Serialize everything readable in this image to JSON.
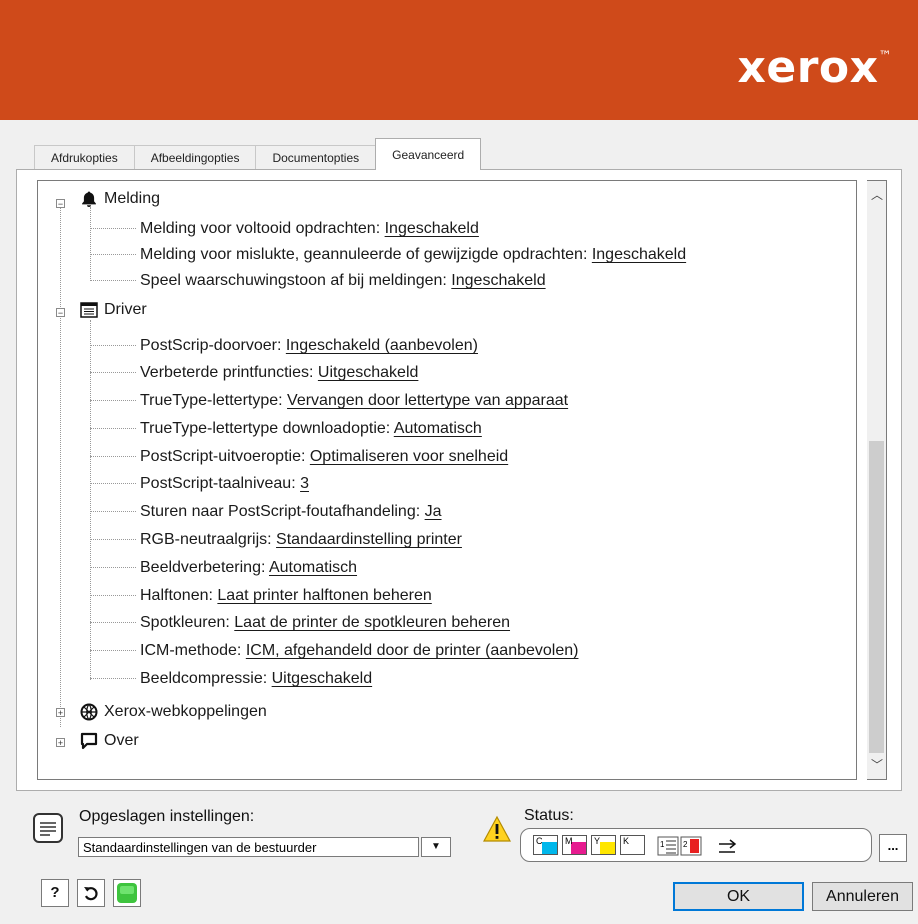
{
  "header": {
    "brand": "xerox",
    "brand_mark": "™",
    "background_color": "#cf4a1a"
  },
  "tabs": [
    {
      "label": "Afdrukopties",
      "active": false
    },
    {
      "label": "Afbeeldingopties",
      "active": false
    },
    {
      "label": "Documentopties",
      "active": false
    },
    {
      "label": "Geavanceerd",
      "active": true
    }
  ],
  "tree": {
    "melding": {
      "label": "Melding",
      "icon": "bell-icon",
      "items": [
        {
          "label": "Melding voor voltooid opdrachten: ",
          "value": "Ingeschakeld"
        },
        {
          "label": "Melding voor mislukte, geannuleerde of gewijzigde opdrachten: ",
          "value": "Ingeschakeld"
        },
        {
          "label": "Speel waarschuwingstoon af bij meldingen: ",
          "value": "Ingeschakeld"
        }
      ]
    },
    "driver": {
      "label": "Driver",
      "icon": "driver-icon",
      "items": [
        {
          "label": "PostScrip-doorvoer: ",
          "value": "Ingeschakeld (aanbevolen)"
        },
        {
          "label": "Verbeterde printfuncties: ",
          "value": "Uitgeschakeld"
        },
        {
          "label": "TrueType-lettertype: ",
          "value": "Vervangen door lettertype van apparaat"
        },
        {
          "label": "TrueType-lettertype downloadoptie: ",
          "value": "Automatisch"
        },
        {
          "label": "PostScript-uitvoeroptie: ",
          "value": "Optimaliseren voor snelheid"
        },
        {
          "label": "PostScript-taalniveau: ",
          "value": "3"
        },
        {
          "label": "Sturen naar PostScript-foutafhandeling: ",
          "value": "Ja"
        },
        {
          "label": "RGB-neutraalgrijs: ",
          "value": "Standaardinstelling printer"
        },
        {
          "label": "Beeldverbetering: ",
          "value": "Automatisch"
        },
        {
          "label": "Halftonen: ",
          "value": "Laat printer halftonen beheren"
        },
        {
          "label": "Spotkleuren: ",
          "value": "Laat de printer de spotkleuren beheren"
        },
        {
          "label": "ICM-methode: ",
          "value": "ICM, afgehandeld door de printer (aanbevolen)"
        },
        {
          "label": "Beeldcompressie: ",
          "value": "Uitgeschakeld"
        }
      ]
    },
    "weblinks": {
      "label": "Xerox-webkoppelingen",
      "icon": "globe-icon"
    },
    "over": {
      "label": "Over",
      "icon": "speech-bubble-icon"
    }
  },
  "saved_settings": {
    "label": "Opgeslagen instellingen:",
    "selected": "Standaardinstellingen van de bestuurder"
  },
  "status": {
    "label": "Status:",
    "cartridges": [
      {
        "letter": "C",
        "color": "#00b7eb"
      },
      {
        "letter": "M",
        "color": "#e61b8f"
      },
      {
        "letter": "Y",
        "color": "#ffe600"
      },
      {
        "letter": "K",
        "color": "#ffffff"
      }
    ]
  },
  "buttons": {
    "more": "...",
    "help": "?",
    "ok": "OK",
    "cancel": "Annuleren"
  }
}
